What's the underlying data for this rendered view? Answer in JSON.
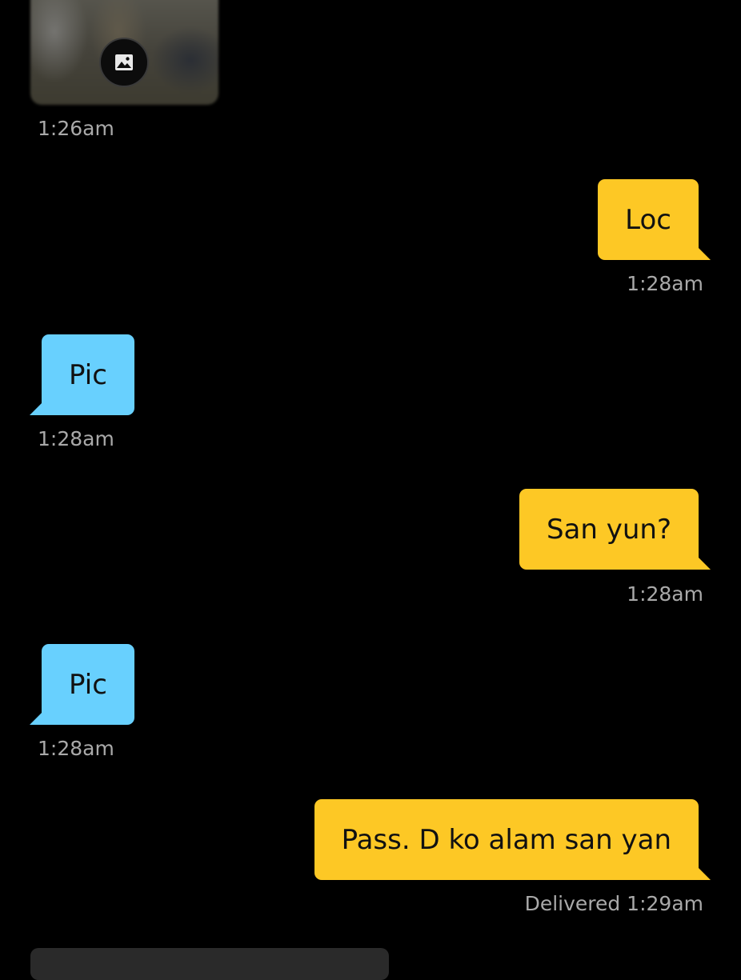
{
  "colors": {
    "background": "#000000",
    "sent_bubble": "#fdc825",
    "received_bubble": "#68d0fe",
    "timestamp": "#a9a9a9"
  },
  "photo_message": {
    "icon": "image-icon",
    "time": "1:26am"
  },
  "messages": [
    {
      "direction": "sent",
      "text": "Loc",
      "time": "1:28am"
    },
    {
      "direction": "received",
      "text": "Pic",
      "time": "1:28am"
    },
    {
      "direction": "sent",
      "text": "San yun?",
      "time": "1:28am"
    },
    {
      "direction": "received",
      "text": "Pic",
      "time": "1:28am"
    },
    {
      "direction": "sent",
      "text": "Pass. D ko alam san yan",
      "time": "Delivered 1:29am"
    }
  ]
}
